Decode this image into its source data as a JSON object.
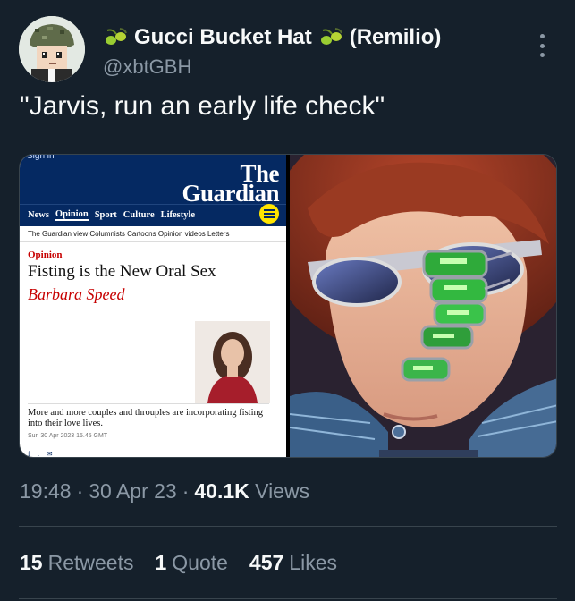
{
  "author": {
    "display_name": "Gucci Bucket Hat",
    "display_suffix": "(Remilio)",
    "handle": "@xbtGBH",
    "avatar_icon": "pixel-soldier-avatar",
    "name_emoji_icon": "olive-icon"
  },
  "tweet": {
    "text": "\"Jarvis, run an early life check\""
  },
  "media": {
    "guardian": {
      "sign_in": "Sign in",
      "logo_line1": "The",
      "logo_line2": "Guardian",
      "nav": [
        "News",
        "Opinion",
        "Sport",
        "Culture",
        "Lifestyle"
      ],
      "nav_active": "Opinion",
      "subnav": "The Guardian view   Columnists   Cartoons   Opinion videos   Letters",
      "kicker": "Opinion",
      "headline": "Fisting is the New Oral Sex",
      "byline": "Barbara Speed",
      "standfirst": "More and more couples and throuples are incorporating fisting into their love lives.",
      "date": "Sun 30 Apr 2023 15.45 GMT",
      "share_icons": [
        "f",
        "t",
        "✉"
      ]
    }
  },
  "meta": {
    "time": "19:48",
    "date": "30 Apr 23",
    "views_count": "40.1K",
    "views_label": "Views"
  },
  "stats": {
    "retweets_count": "15",
    "retweets_label": "Retweets",
    "quotes_count": "1",
    "quotes_label": "Quote",
    "likes_count": "457",
    "likes_label": "Likes"
  },
  "colors": {
    "background": "#15202b",
    "text_primary": "#f7f9f9",
    "text_secondary": "#8b98a5",
    "guardian_blue": "#052962",
    "guardian_red": "#c70000"
  }
}
